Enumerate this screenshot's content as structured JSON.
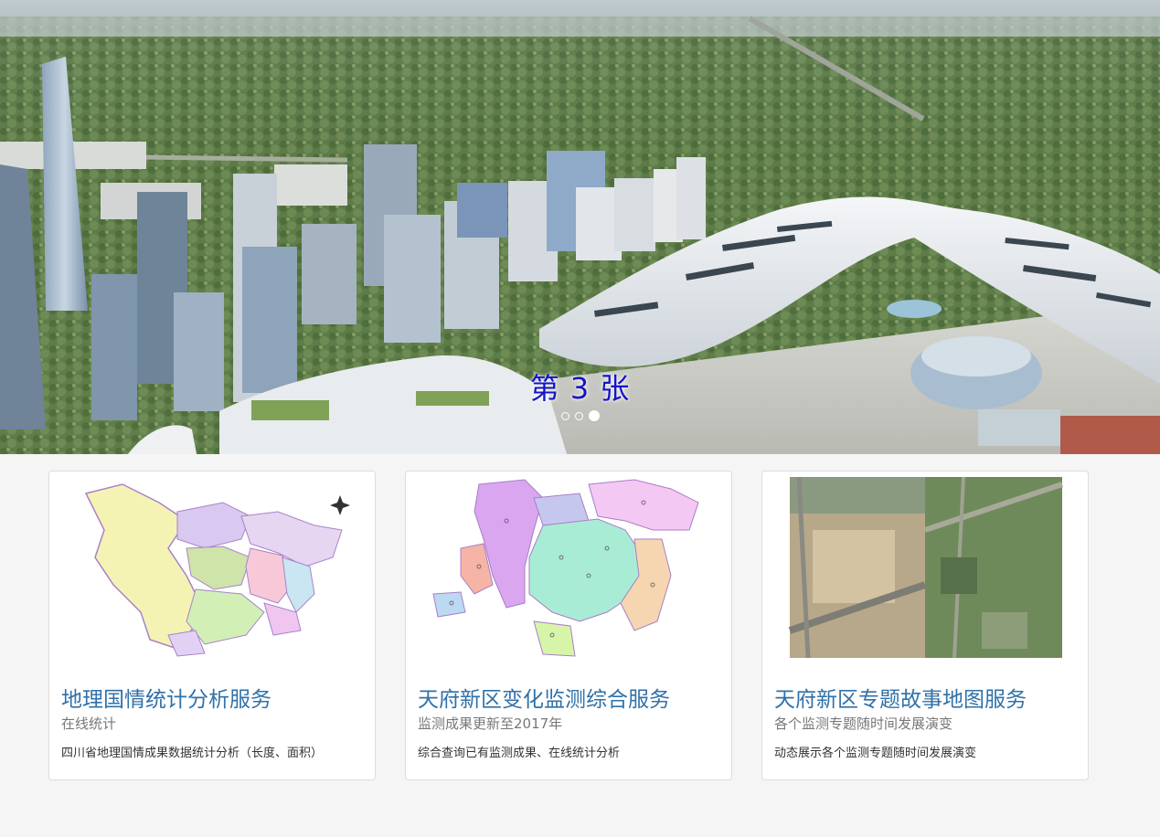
{
  "carousel": {
    "caption": "第 3 张",
    "active_index": 3,
    "slide_count": 3
  },
  "cards": [
    {
      "title": "地理国情统计分析服务",
      "subtitle": "在线统计",
      "description": "四川省地理国情成果数据统计分析（长度、面积）",
      "image": "sichuan-province-map"
    },
    {
      "title": "天府新区变化监测综合服务",
      "subtitle": "监测成果更新至2017年",
      "description": "综合查询已有监测成果、在线统计分析",
      "image": "tianfu-district-map"
    },
    {
      "title": "天府新区专题故事地图服务",
      "subtitle": "各个监测专题随时间发展演变",
      "description": "动态展示各个监测专题随时间发展演变",
      "image": "satellite-comparison"
    }
  ],
  "colors": {
    "card_title": "#3071a9",
    "caption": "#1515c8",
    "page_bg": "#f5f5f5"
  }
}
